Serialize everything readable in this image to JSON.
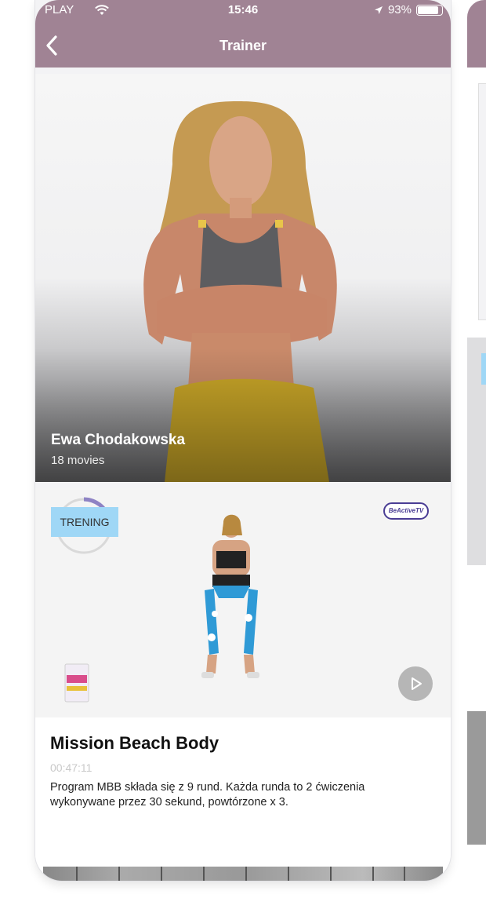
{
  "status_bar": {
    "carrier": "PLAY",
    "time": "15:46",
    "battery": "93%",
    "battery_level": 0.93
  },
  "header": {
    "title": "Trainer",
    "background": "#a08394"
  },
  "trainer": {
    "name": "Ewa Chodakowska",
    "movies": "18 movies"
  },
  "video_card": {
    "badge": "TRENING",
    "badge_color": "#9fd7f6",
    "logo_text": "BeActiveTV",
    "title": "Mission Beach Body",
    "duration": "00:47:11",
    "description": "Program MBB składa się z 9 rund. Każda runda to 2 ćwiczenia wykonywane przez 30 sekund, powtórzone x 3."
  },
  "icons": [
    "back-chevron-icon",
    "wifi-icon",
    "location-arrow-icon",
    "battery-icon",
    "play-icon"
  ]
}
